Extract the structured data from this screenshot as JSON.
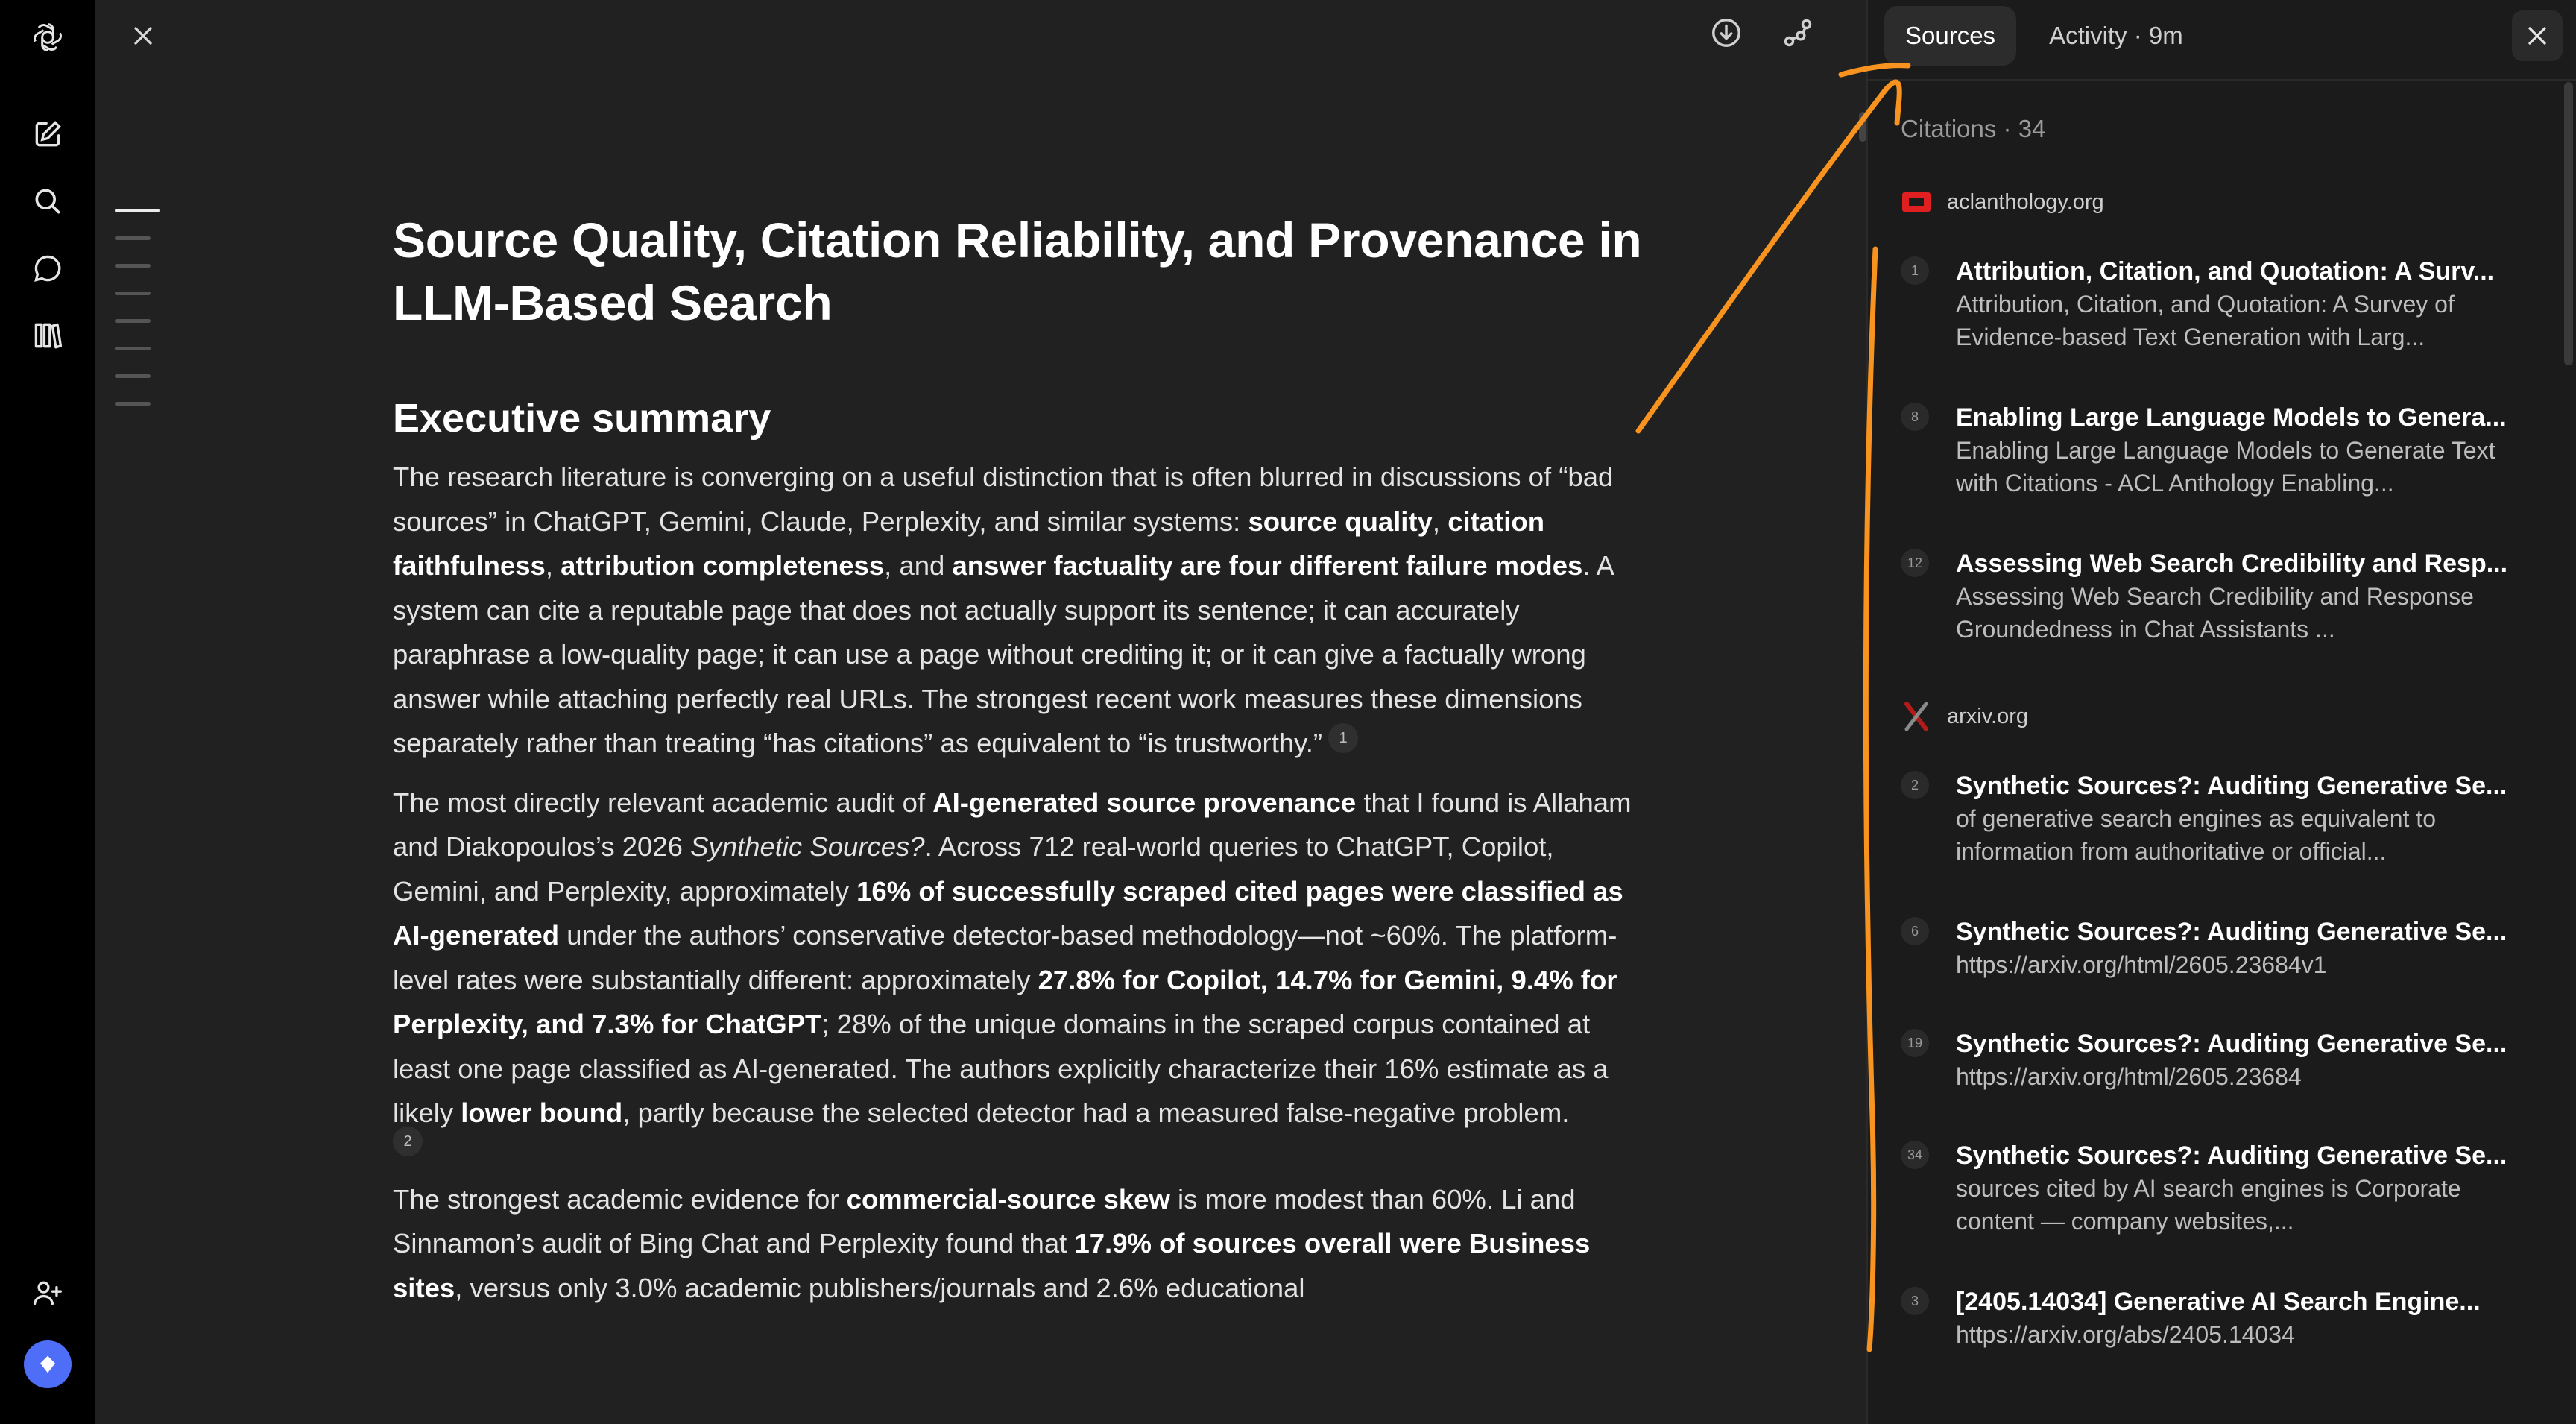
{
  "rail": {
    "icons": [
      "chatgpt-logo-icon",
      "new-chat-icon",
      "search-icon",
      "chat-bubble-icon",
      "library-icon",
      "add-people-icon",
      "upgrade-icon"
    ]
  },
  "document": {
    "title": "Source Quality, Citation Reliability, and Provenance in LLM-Based Search",
    "section_heading": "Executive summary",
    "p1": {
      "t1": "The research literature is converging on a useful distinction that is often blurred in discussions of “bad sources” in ChatGPT, Gemini, Claude, Perplexity, and similar systems: ",
      "b1": "source quality",
      "t2": ", ",
      "b2": "citation faithfulness",
      "t3": ", ",
      "b3": "attribution completeness",
      "t4": ", and ",
      "b4": "answer factuality are four different failure modes",
      "t5": ". A system can cite a reputable page that does not actually support its sentence; it can accurately paraphrase a low-quality page; it can use a page without crediting it; or it can give a factually wrong answer while attaching perfectly real URLs. The strongest recent work measures these dimensions separately rather than treating “has citations” as equivalent to “is trustworthy.”",
      "cite": "1"
    },
    "p2": {
      "t1": "The most directly relevant academic audit of ",
      "b1": "AI-generated source provenance",
      "t2": " that I found is Allaham and Diakopoulos’s 2026 ",
      "i1": "Synthetic Sources?",
      "t3": ". Across 712 real-world queries to ChatGPT, Copilot, Gemini, and Perplexity, approximately ",
      "b2": "16% of successfully scraped cited pages were classified as AI-generated",
      "t4": " under the authors’ conservative detector-based methodology—not ~60%. The platform-level rates were substantially different: approximately ",
      "b3": "27.8% for Copilot, 14.7% for Gemini, 9.4% for Perplexity, and 7.3% for ChatGPT",
      "t5": "; 28% of the unique domains in the scraped corpus contained at least one page classified as AI-generated. The authors explicitly characterize their 16% estimate as a likely ",
      "b4": "lower bound",
      "t6": ", partly because the selected detector had a measured false-negative problem.",
      "cite": "2"
    },
    "p3": {
      "t1": "The strongest academic evidence for ",
      "b1": "commercial-source skew",
      "t2": " is more modest than 60%. Li and Sinnamon’s audit of Bing Chat and Perplexity found that ",
      "b2": "17.9% of sources overall were Business sites",
      "t3": ", versus only 3.0% academic publishers/journals and 2.6% educational"
    }
  },
  "panel": {
    "tabs": [
      "Sources",
      "Activity · 9m"
    ],
    "active_tab": "Sources",
    "citations_label": "Citations · 34",
    "groups": [
      {
        "domain": "aclanthology.org",
        "logo": "acl-logo-icon",
        "items": [
          {
            "num": "1",
            "title": "Attribution, Citation, and Quotation: A Surv...",
            "sub": "Attribution, Citation, and Quotation: A Survey of Evidence-based Text Generation with Larg..."
          },
          {
            "num": "8",
            "title": "Enabling Large Language Models to Genera...",
            "sub": "Enabling Large Language Models to Generate Text with Citations - ACL Anthology Enabling..."
          },
          {
            "num": "12",
            "title": "Assessing Web Search Credibility and Resp...",
            "sub": "Assessing Web Search Credibility and Response Groundedness in Chat Assistants ..."
          }
        ]
      },
      {
        "domain": "arxiv.org",
        "logo": "arxiv-logo-icon",
        "items": [
          {
            "num": "2",
            "title": "Synthetic Sources?: Auditing Generative Se...",
            "sub": "of generative search engines as equivalent to information from authoritative or official..."
          },
          {
            "num": "6",
            "title": "Synthetic Sources?: Auditing Generative Se...",
            "sub": "https://arxiv.org/html/2605.23684v1"
          },
          {
            "num": "19",
            "title": "Synthetic Sources?: Auditing Generative Se...",
            "sub": "https://arxiv.org/html/2605.23684"
          },
          {
            "num": "34",
            "title": "Synthetic Sources?: Auditing Generative Se...",
            "sub": "sources cited by AI search engines is Corporate content — company websites,..."
          },
          {
            "num": "3",
            "title": "[2405.14034] Generative AI Search Engine...",
            "sub": "https://arxiv.org/abs/2405.14034"
          }
        ]
      }
    ]
  },
  "colors": {
    "annotation": "#f7931e",
    "accent": "#4f6ef7",
    "background": "#212121"
  }
}
